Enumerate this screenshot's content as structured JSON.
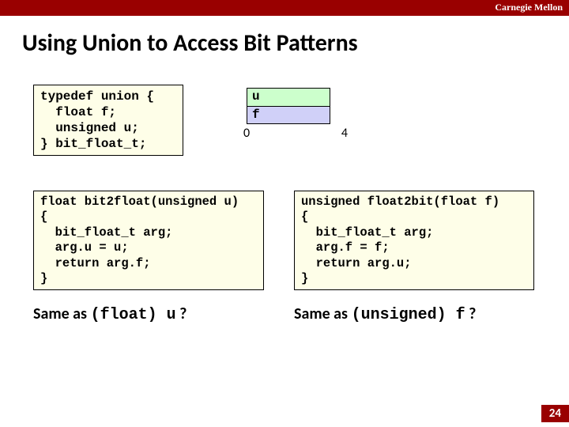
{
  "header": {
    "brand": "Carnegie Mellon"
  },
  "title": "Using Union to Access Bit Patterns",
  "typedef_code": "typedef union {\n  float f;\n  unsigned u;\n} bit_float_t;",
  "union_box": {
    "row_u": "u",
    "row_f": "f",
    "tick_left": "0",
    "tick_right": "4"
  },
  "left": {
    "code": "float bit2float(unsigned u)\n{\n  bit_float_t arg;\n  arg.u = u;\n  return arg.f;\n}",
    "q_pre": "Same as ",
    "q_mono": "(float) u",
    "q_post": " ?"
  },
  "right": {
    "code": "unsigned float2bit(float f)\n{\n  bit_float_t arg;\n  arg.f = f;\n  return arg.u;\n}",
    "q_pre": "Same as ",
    "q_mono": "(unsigned) f",
    "q_post": " ?"
  },
  "page_number": "24"
}
